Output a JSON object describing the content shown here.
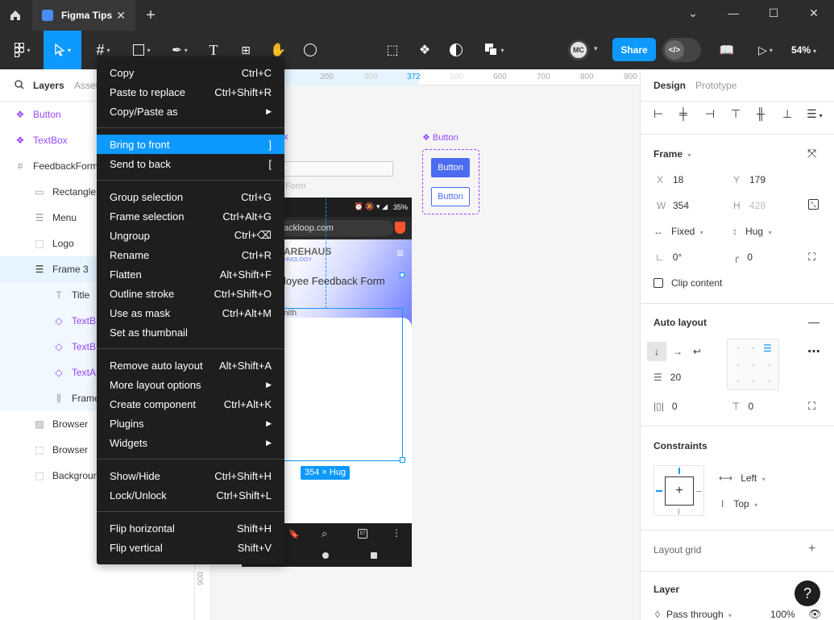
{
  "titlebar": {
    "tab_title": "Figma Tips"
  },
  "toolbar": {
    "share_label": "Share",
    "zoom": "54%",
    "avatar_initials": "MC",
    "dev_mode_glyph": "</>"
  },
  "layers_panel": {
    "tabs": [
      "Layers",
      "Assets"
    ],
    "items": [
      {
        "name": "Button",
        "icon": "component-icon",
        "indent": 0
      },
      {
        "name": "TextBox",
        "icon": "component-icon",
        "indent": 0
      },
      {
        "name": "FeedbackForm",
        "icon": "frame-icon",
        "indent": 0
      },
      {
        "name": "Rectangle",
        "icon": "rectangle-icon",
        "indent": 1
      },
      {
        "name": "Menu",
        "icon": "menu-icon",
        "indent": 1
      },
      {
        "name": "Logo",
        "icon": "dashed-frame-icon",
        "indent": 1
      },
      {
        "name": "Frame 3",
        "icon": "auto-layout-icon",
        "indent": 1
      },
      {
        "name": "Title",
        "icon": "text-icon",
        "indent": 2
      },
      {
        "name": "TextB",
        "icon": "instance-icon",
        "indent": 2
      },
      {
        "name": "TextB",
        "icon": "instance-icon",
        "indent": 2
      },
      {
        "name": "TextA",
        "icon": "instance-icon",
        "indent": 2
      },
      {
        "name": "Frame",
        "icon": "columns-icon",
        "indent": 2
      },
      {
        "name": "Browser",
        "icon": "image-icon",
        "indent": 1
      },
      {
        "name": "Browser",
        "icon": "dashed-frame-icon",
        "indent": 1
      },
      {
        "name": "Background",
        "icon": "dashed-frame-icon",
        "indent": 1
      }
    ]
  },
  "ruler": {
    "ticks": [
      "200",
      "300",
      "372",
      "500",
      "600",
      "700",
      "800",
      "900"
    ],
    "vertical_tick": "900"
  },
  "canvas": {
    "button_component_label": "Button",
    "button_primary": "Button",
    "button_secondary": "Button",
    "partial_form_label": "Form",
    "partial_x_label": "x",
    "url_text": "ackloop.com",
    "status_battery": "35%",
    "brand_text": "AREHAUS",
    "brand_sub": "HNOLOGY",
    "form_title": "loyee Feedback Form",
    "field_partial": "nith",
    "size_badge": "354 × Hug"
  },
  "context_menu": {
    "groups": [
      [
        {
          "label": "Copy",
          "shortcut": "Ctrl+C"
        },
        {
          "label": "Paste to replace",
          "shortcut": "Ctrl+Shift+R"
        },
        {
          "label": "Copy/Paste as",
          "submenu": true
        }
      ],
      [
        {
          "label": "Bring to front",
          "shortcut": "]",
          "highlighted": true
        },
        {
          "label": "Send to back",
          "shortcut": "["
        }
      ],
      [
        {
          "label": "Group selection",
          "shortcut": "Ctrl+G"
        },
        {
          "label": "Frame selection",
          "shortcut": "Ctrl+Alt+G"
        },
        {
          "label": "Ungroup",
          "shortcut": "Ctrl+⌫"
        },
        {
          "label": "Rename",
          "shortcut": "Ctrl+R"
        },
        {
          "label": "Flatten",
          "shortcut": "Alt+Shift+F"
        },
        {
          "label": "Outline stroke",
          "shortcut": "Ctrl+Shift+O"
        },
        {
          "label": "Use as mask",
          "shortcut": "Ctrl+Alt+M"
        },
        {
          "label": "Set as thumbnail"
        }
      ],
      [
        {
          "label": "Remove auto layout",
          "shortcut": "Alt+Shift+A"
        },
        {
          "label": "More layout options",
          "submenu": true
        },
        {
          "label": "Create component",
          "shortcut": "Ctrl+Alt+K"
        },
        {
          "label": "Plugins",
          "submenu": true
        },
        {
          "label": "Widgets",
          "submenu": true
        }
      ],
      [
        {
          "label": "Show/Hide",
          "shortcut": "Ctrl+Shift+H"
        },
        {
          "label": "Lock/Unlock",
          "shortcut": "Ctrl+Shift+L"
        }
      ],
      [
        {
          "label": "Flip horizontal",
          "shortcut": "Shift+H"
        },
        {
          "label": "Flip vertical",
          "shortcut": "Shift+V"
        }
      ]
    ]
  },
  "design_panel": {
    "tabs": [
      "Design",
      "Prototype"
    ],
    "frame": {
      "title": "Frame",
      "x": "18",
      "y": "179",
      "w": "354",
      "h": "428",
      "width_mode": "Fixed",
      "height_mode": "Hug",
      "rotation": "0°",
      "radius": "0",
      "clip_content": "Clip content"
    },
    "auto_layout": {
      "title": "Auto layout",
      "gap": "20",
      "padding_h": "0",
      "padding_v": "0"
    },
    "constraints": {
      "title": "Constraints",
      "horizontal": "Left",
      "vertical": "Top"
    },
    "layout_grid": {
      "title": "Layout grid"
    },
    "layer": {
      "title": "Layer",
      "blend": "Pass through",
      "opacity": "100%"
    },
    "labels": {
      "x": "X",
      "y": "Y",
      "w": "W",
      "h": "H"
    }
  },
  "colors": {
    "accent": "#0d99ff",
    "component": "#9747ff",
    "menu_bg": "#1e1e1e",
    "chrome": "#2c2c2c"
  }
}
